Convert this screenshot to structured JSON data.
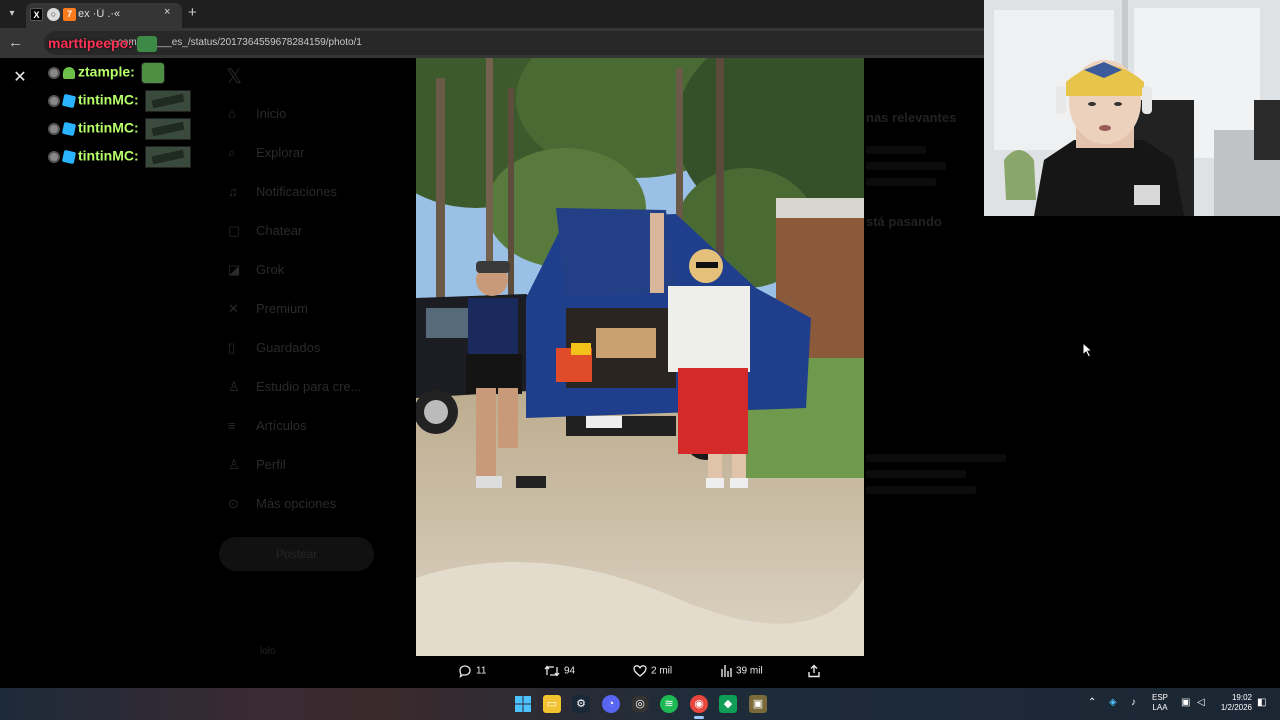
{
  "browser": {
    "tab_title": "ex ·Ú .·«",
    "url": "x.com/lolo___es_/status/2017364559678284159/photo/1",
    "new_tab_symbol": "+",
    "close_symbol": "×"
  },
  "overlay_top_user": "marttipeepo:",
  "chat": [
    {
      "user": "ztample:",
      "badge": "sprout",
      "emote": "plant"
    },
    {
      "user": "tintinMC:",
      "badge": "cube",
      "emote": "cutscene"
    },
    {
      "user": "tintinMC:",
      "badge": "cube",
      "emote": "cutscene"
    },
    {
      "user": "tintinMC:",
      "badge": "cube",
      "emote": "cutscene"
    }
  ],
  "twitter_nav": [
    {
      "label": "Inicio",
      "icon": "home-icon",
      "glyph": "⌂"
    },
    {
      "label": "Explorar",
      "icon": "search-icon",
      "glyph": "⌕"
    },
    {
      "label": "Notificaciones",
      "icon": "bell-icon",
      "glyph": "♫"
    },
    {
      "label": "Chatear",
      "icon": "chat-icon",
      "glyph": "▢"
    },
    {
      "label": "Grok",
      "icon": "grok-icon",
      "glyph": "◪"
    },
    {
      "label": "Premium",
      "icon": "x-icon",
      "glyph": "✕"
    },
    {
      "label": "Guardados",
      "icon": "bookmark-icon",
      "glyph": "▯"
    },
    {
      "label": "Estudio para cre...",
      "icon": "studio-icon",
      "glyph": "♙"
    },
    {
      "label": "Artículos",
      "icon": "articles-icon",
      "glyph": "≡"
    },
    {
      "label": "Perfil",
      "icon": "profile-icon",
      "glyph": "♙"
    },
    {
      "label": "Más opciones",
      "icon": "more-icon",
      "glyph": "⊙"
    }
  ],
  "twitter_post_button": "Postear",
  "twitter_account": "lolo",
  "twitter_right": {
    "heading_1": "nas relevantes",
    "heading_2": "stá pasando"
  },
  "actions": {
    "replies": "11",
    "reposts": "94",
    "likes": "2 mil",
    "views": "39 mil"
  },
  "taskbar": {
    "lang_1": "ESP",
    "lang_2": "LAA",
    "time": "19:02",
    "date": "1/2/2026"
  }
}
